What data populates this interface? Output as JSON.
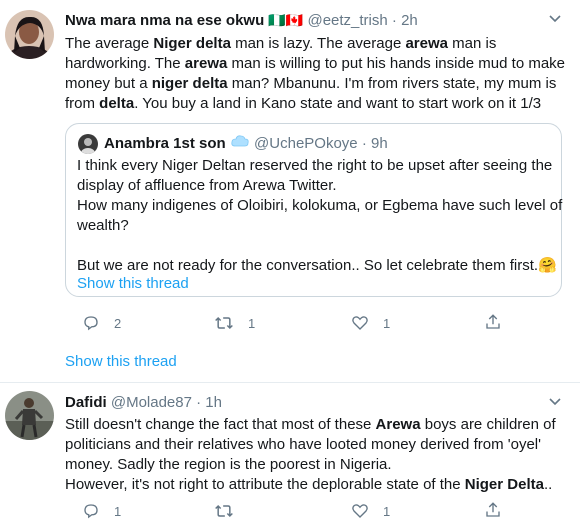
{
  "tweets": [
    {
      "author": "Nwa mara nma na ese okwu",
      "flags": "🇳🇬🇨🇦",
      "handle": "@eetz_trish",
      "time": "2h",
      "lines": [
        [
          "The average ",
          {
            "b": "Niger delta"
          },
          " man is lazy. The average ",
          {
            "b": "arewa"
          },
          " man is"
        ],
        [
          "hardworking. The ",
          {
            "b": "arewa"
          },
          " man is willing to put his hands inside mud to make"
        ],
        [
          "money but a ",
          {
            "b": "niger delta"
          },
          " man? Mbanunu. I'm from rivers state, my mum is"
        ],
        [
          "from ",
          {
            "b": "delta"
          },
          ". You buy a land in Kano state and want to start work on it 1/3"
        ]
      ],
      "quote": {
        "author": "Anambra 1st son",
        "handle": "@UchePOkoye",
        "time": "9h",
        "lines": [
          "I think every Niger Deltan reserved the right to be upset after seeing the",
          "display of affluence from Arewa Twitter.",
          "How many indigenes of Oloibiri, kolokuma, or Egbema have such level of",
          "wealth?",
          "",
          "But we are not ready for the conversation.. So let celebrate them first.🤗"
        ],
        "show_thread": "Show this thread"
      },
      "replies": "2",
      "retweets": "1",
      "likes": "1",
      "show_thread": "Show this thread"
    },
    {
      "author": "Dafidi",
      "handle": "@Molade87",
      "time": "1h",
      "lines": [
        [
          "Still doesn't change the fact that most of these ",
          {
            "b": "Arewa"
          },
          " boys are children of"
        ],
        [
          "politicians and their relatives who have looted money derived from 'oyel'"
        ],
        [
          "money. Sadly the region is the poorest in Nigeria."
        ],
        [
          "However, it's not right to attribute the deplorable state of the ",
          {
            "b": "Niger Delta"
          },
          ".."
        ]
      ],
      "replies": "1",
      "retweets": "",
      "likes": "1"
    }
  ],
  "colors": {
    "accent": "#1da1f2",
    "muted": "#657786",
    "text": "#14171a",
    "border": "#ccd6dd"
  },
  "icons": [
    "reply-icon",
    "retweet-icon",
    "like-icon",
    "share-icon",
    "caret-down-icon",
    "verified-cloud-icon"
  ]
}
